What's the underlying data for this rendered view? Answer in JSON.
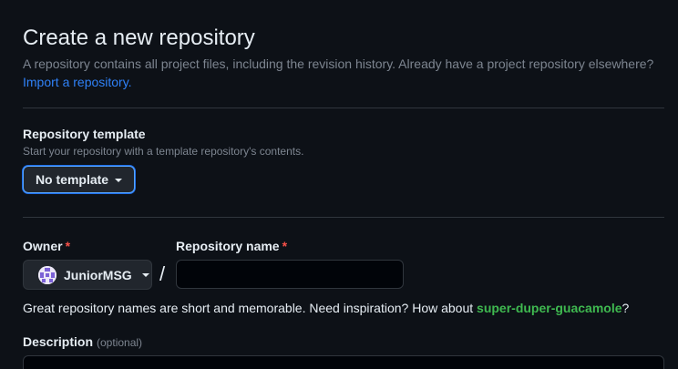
{
  "header": {
    "title": "Create a new repository",
    "subtitle": "A repository contains all project files, including the revision history. Already have a project repository elsewhere?",
    "import_link": "Import a repository."
  },
  "template": {
    "label": "Repository template",
    "hint": "Start your repository with a template repository's contents.",
    "selected": "No template"
  },
  "owner": {
    "label": "Owner",
    "required_mark": "*",
    "value": "JuniorMSG"
  },
  "repo_name": {
    "label": "Repository name",
    "required_mark": "*",
    "value": "",
    "separator": "/"
  },
  "suggestion": {
    "text": "Great repository names are short and memorable. Need inspiration? How about",
    "name": "super-duper-guacamole",
    "suffix": "?"
  },
  "description": {
    "label": "Description",
    "optional": "(optional)",
    "value": ""
  },
  "colors": {
    "background": "#0d1117",
    "link": "#2f81f7",
    "success": "#3fb950",
    "danger": "#f85149",
    "border": "#30363d",
    "focus": "#58a6ff"
  }
}
